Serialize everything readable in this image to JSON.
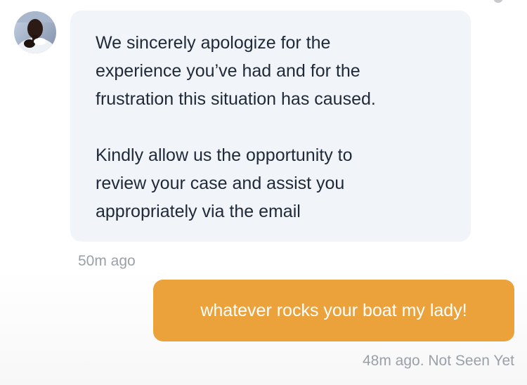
{
  "messages": [
    {
      "direction": "incoming",
      "paragraphs": [
        "We sincerely apologize for the\nexperience you’ve had and for the\nfrustration this situation has caused.",
        "Kindly allow us the opportunity to\nreview your case and assist you\nappropriately via the email"
      ],
      "time": "50m ago",
      "avatar_icon": "user-photo-avatar"
    },
    {
      "direction": "outgoing",
      "text": "whatever rocks your boat my lady!",
      "status": "48m ago. Not Seen Yet"
    }
  ],
  "colors": {
    "incoming_bubble": "#f1f4f8",
    "incoming_text": "#1f2937",
    "outgoing_bubble": "#eba23b",
    "outgoing_text": "#ffffff",
    "meta_text": "#9aa0a8"
  }
}
